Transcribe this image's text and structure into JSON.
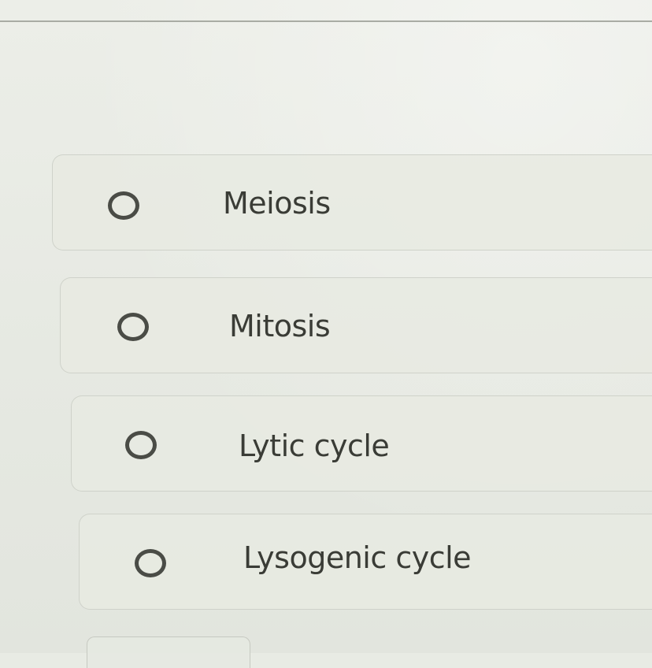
{
  "question": {
    "options": [
      {
        "label": "Meiosis",
        "selected": false
      },
      {
        "label": "Mitosis",
        "selected": false
      },
      {
        "label": "Lytic cycle",
        "selected": false
      },
      {
        "label": "Lysogenic cycle",
        "selected": false
      }
    ]
  }
}
